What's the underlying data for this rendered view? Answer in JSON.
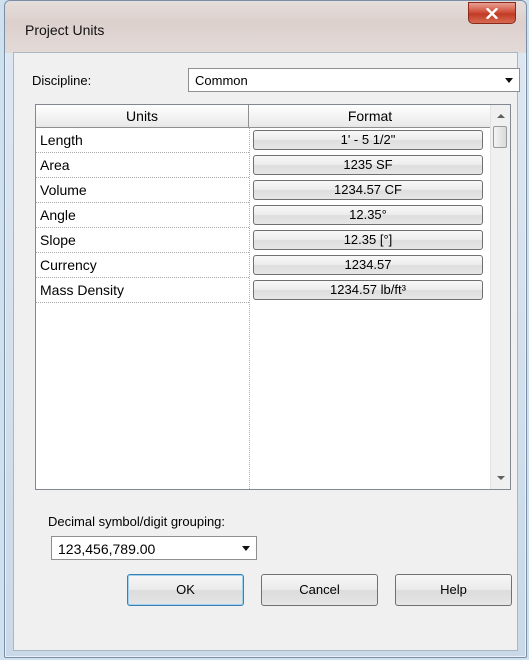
{
  "window": {
    "title": "Project Units"
  },
  "discipline": {
    "label": "Discipline:",
    "value": "Common"
  },
  "grid": {
    "headers": {
      "units": "Units",
      "format": "Format"
    },
    "rows": [
      {
        "unit": "Length",
        "format": "1' - 5 1/2\""
      },
      {
        "unit": "Area",
        "format": "1235 SF"
      },
      {
        "unit": "Volume",
        "format": "1234.57 CF"
      },
      {
        "unit": "Angle",
        "format": "12.35°"
      },
      {
        "unit": "Slope",
        "format": "12.35 [°]"
      },
      {
        "unit": "Currency",
        "format": "1234.57"
      },
      {
        "unit": "Mass Density",
        "format": "1234.57 lb/ft³"
      }
    ]
  },
  "decimal": {
    "label": "Decimal symbol/digit grouping:",
    "value": "123,456,789.00"
  },
  "buttons": {
    "ok": "OK",
    "cancel": "Cancel",
    "help": "Help"
  },
  "icons": {
    "close": "close-icon",
    "dropdown": "chevron-down-icon"
  }
}
